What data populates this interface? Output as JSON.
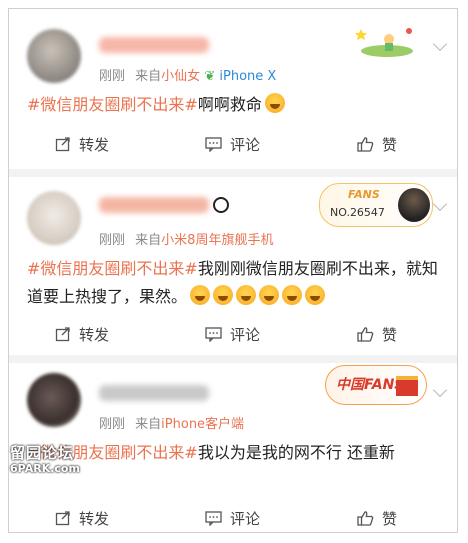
{
  "posts": [
    {
      "time": "刚刚",
      "source_prefix": "来自",
      "source": "小仙女",
      "device": "iPhone X",
      "hashtag": "#微信朋友圈刷不出来#",
      "text": "啊啊救命"
    },
    {
      "time": "刚刚",
      "source_prefix": "来自",
      "source": "小米8周年旗舰手机",
      "hashtag": "#微信朋友圈刷不出来#",
      "text": "我刚刚微信朋友圈刷不出来，就知道要上热搜了，果然。",
      "badge_title": "FANS",
      "badge_no": "NO.26547"
    },
    {
      "time": "刚刚",
      "source_prefix": "来自",
      "source": "iPhone客户端",
      "hashtag": "#微信朋友圈刷不出来#",
      "text": "我以为是我的网不行 还重新",
      "badge_title": "中国FANS"
    }
  ],
  "actions": {
    "repost": "转发",
    "comment": "评论",
    "like": "赞"
  },
  "watermark": {
    "line1": "留园论坛",
    "line2": "6PARK.com"
  },
  "colors": {
    "accent": "#eb7350",
    "meta": "#8a8a8a",
    "separator": "#f2f2f2"
  }
}
